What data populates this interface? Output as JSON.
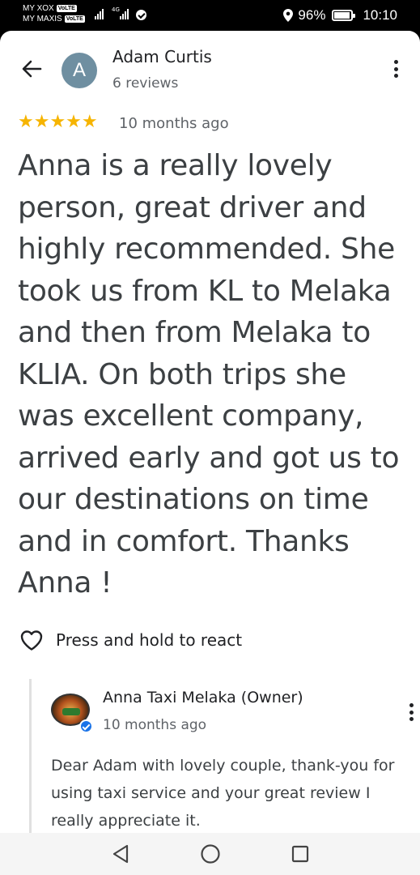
{
  "status_bar": {
    "carrier_1": "MY XOX",
    "carrier_2": "MY MAXIS",
    "volte_badge": "VoLTE",
    "network_type": "4G",
    "battery": "96%",
    "time": "10:10"
  },
  "review": {
    "avatar_letter": "A",
    "reviewer_name": "Adam Curtis",
    "review_count": "6 reviews",
    "stars": "★★★★★",
    "rating": 5,
    "date": "10 months ago",
    "text": "Anna is a really lovely person, great driver and highly recommended. She took us from KL to Melaka and then from Melaka to KLIA. On both trips she was excellent company, arrived early and got us to our destinations on time and in comfort. Thanks Anna !"
  },
  "react": {
    "label": "Press and hold to react"
  },
  "owner_reply": {
    "name": "Anna Taxi Melaka (Owner)",
    "date": "10 months ago",
    "text": "Dear Adam with lovely couple, thank-you for using taxi service and your great review I really appreciate it."
  },
  "icons": {
    "back": "arrow-left-icon",
    "more": "more-vert-icon",
    "heart": "heart-outline-icon",
    "nav_back": "triangle-back-icon",
    "nav_home": "circle-home-icon",
    "nav_recents": "square-recents-icon"
  },
  "colors": {
    "star": "#f6b400",
    "avatar_bg": "#6f8fa1",
    "verified": "#1a73e8",
    "text_primary": "#202124",
    "text_secondary": "#5f6368"
  }
}
